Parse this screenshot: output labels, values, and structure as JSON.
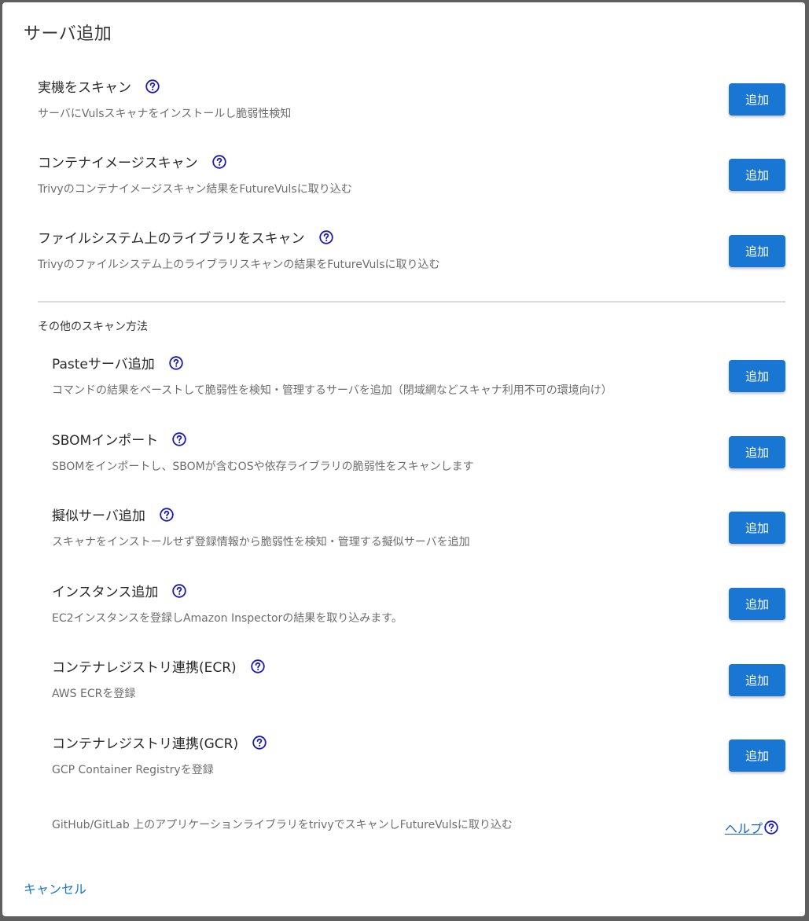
{
  "dialog": {
    "title": "サーバ追加"
  },
  "primary_items": [
    {
      "title": "実機をスキャン",
      "description": "サーバにVulsスキャナをインストールし脆弱性検知",
      "button": "追加"
    },
    {
      "title": "コンテナイメージスキャン",
      "description": "Trivyのコンテナイメージスキャン結果をFutureVulsに取り込む",
      "button": "追加"
    },
    {
      "title": "ファイルシステム上のライブラリをスキャン",
      "description": "Trivyのファイルシステム上のライブラリスキャンの結果をFutureVulsに取り込む",
      "button": "追加"
    }
  ],
  "other_section": {
    "label": "その他のスキャン方法",
    "items": [
      {
        "title": "Pasteサーバ追加",
        "description": "コマンドの結果をペーストして脆弱性を検知・管理するサーバを追加（閉域網などスキャナ利用不可の環境向け）",
        "button": "追加"
      },
      {
        "title": "SBOMインポート",
        "description": "SBOMをインポートし、SBOMが含むOSや依存ライブラリの脆弱性をスキャンします",
        "button": "追加"
      },
      {
        "title": "擬似サーバ追加",
        "description": "スキャナをインストールせず登録情報から脆弱性を検知・管理する擬似サーバを追加",
        "button": "追加"
      },
      {
        "title": "インスタンス追加",
        "description": "EC2インスタンスを登録しAmazon Inspectorの結果を取り込みます。",
        "button": "追加"
      },
      {
        "title": "コンテナレジストリ連携(ECR)",
        "description": "AWS ECRを登録",
        "button": "追加"
      },
      {
        "title": "コンテナレジストリ連携(GCR)",
        "description": "GCP Container Registryを登録",
        "button": "追加"
      }
    ],
    "github_text": "GitHub/GitLab 上のアプリケーションライブラリをtrivyでスキャンしFutureVulsに取り込む",
    "help_link": "ヘルプ"
  },
  "footer": {
    "cancel": "キャンセル"
  },
  "icons": {
    "help": "help-circle-icon"
  },
  "colors": {
    "primary_button": "#1976d2",
    "help_icon": "#1a1ab8",
    "link": "#1976d2"
  }
}
